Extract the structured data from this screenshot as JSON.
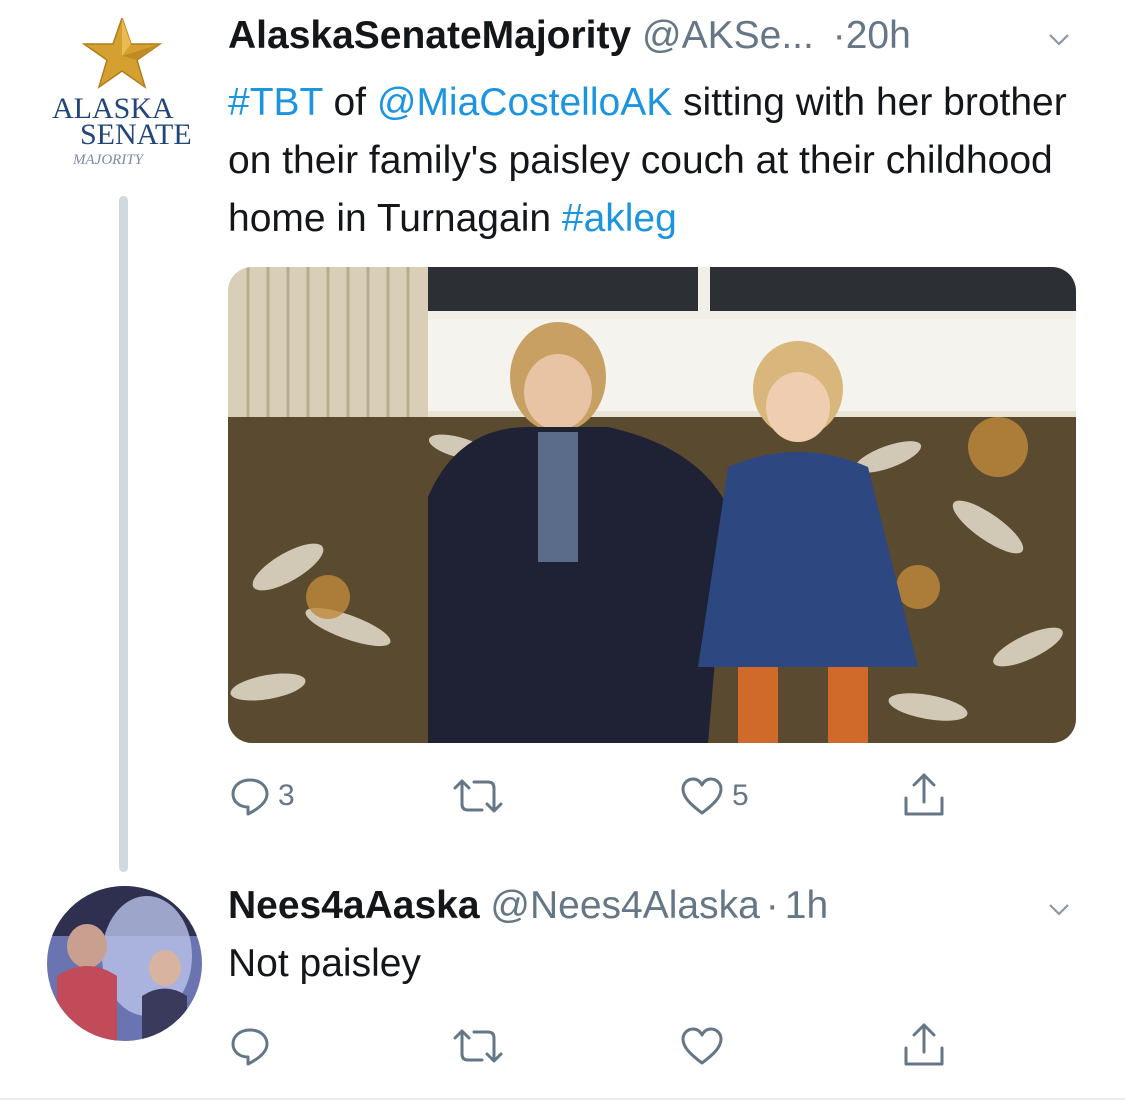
{
  "tweet": {
    "author_name": "AlaskaSenateMajority",
    "handle": "@AKSe...",
    "separator": "·",
    "time": "20h",
    "text_parts": [
      {
        "text": "#TBT",
        "link": true
      },
      {
        "text": " of ",
        "link": false
      },
      {
        "text": "@MiaCostelloAK",
        "link": true
      },
      {
        "text": " sitting with her brother on their family's paisley couch at their childhood home in Turnagain ",
        "link": false
      },
      {
        "text": "#akleg",
        "link": true
      }
    ],
    "avatar": {
      "line1": "ALASKA",
      "line2": "SENATE",
      "line3": "MAJORITY",
      "star_color": "#d4a030",
      "text_color": "#23467a"
    },
    "actions": {
      "reply_icon": "reply-icon",
      "reply_count": "3",
      "retweet_icon": "retweet-icon",
      "retweet_count": "",
      "like_icon": "heart-icon",
      "like_count": "5",
      "share_icon": "share-icon"
    }
  },
  "reply": {
    "author_name": "Nees4aAaska",
    "handle": "@Nees4Alaska",
    "separator": "·",
    "time": "1h",
    "text": "Not paisley",
    "actions": {
      "reply_icon": "reply-icon",
      "retweet_icon": "retweet-icon",
      "like_icon": "heart-icon",
      "share_icon": "share-icon"
    }
  },
  "colors": {
    "link": "#1b95e0",
    "secondary": "#657786",
    "thread_line": "#cfd9de"
  }
}
